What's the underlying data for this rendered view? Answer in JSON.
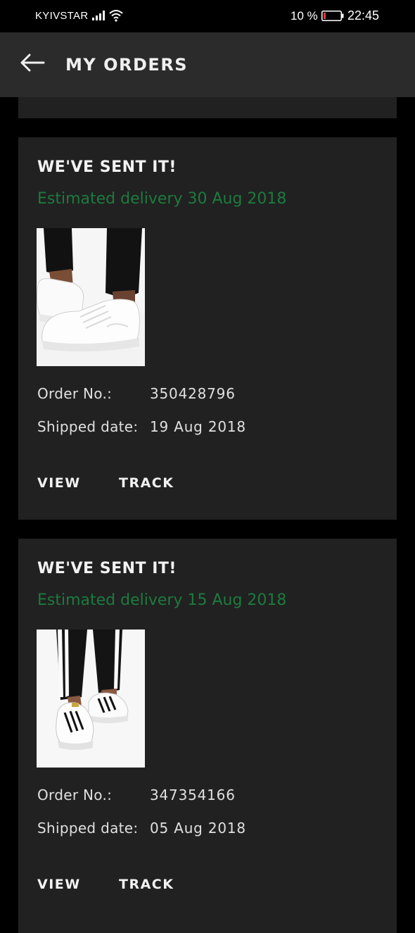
{
  "status_bar": {
    "carrier": "KYIVSTAR",
    "battery_percent": "10 %",
    "time": "22:45",
    "battery_color": "#e53935"
  },
  "header": {
    "title": "MY ORDERS",
    "back_icon": "arrow-left-icon"
  },
  "orders": [
    {
      "status": "WE'VE SENT IT!",
      "estimated_delivery": "Estimated delivery 30 Aug 2018",
      "order_no_label": "Order No.:",
      "order_no": "350428796",
      "shipped_label": "Shipped date:",
      "shipped_date": "19 Aug 2018",
      "view_label": "VIEW",
      "track_label": "TRACK",
      "product_image": "white-sneakers-image"
    },
    {
      "status": "WE'VE SENT IT!",
      "estimated_delivery": "Estimated delivery 15 Aug 2018",
      "order_no_label": "Order No.:",
      "order_no": "347354166",
      "shipped_label": "Shipped date:",
      "shipped_date": "05 Aug 2018",
      "view_label": "VIEW",
      "track_label": "TRACK",
      "product_image": "striped-sneakers-image"
    }
  ],
  "colors": {
    "background": "#000000",
    "app_bar": "#2b2b2b",
    "card": "#212121",
    "accent_green": "#1d7a3e"
  }
}
